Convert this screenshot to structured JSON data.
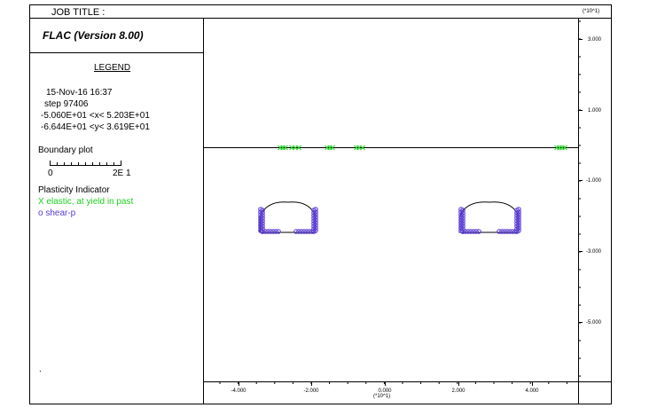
{
  "header": {
    "job_title_label": "JOB TITLE :",
    "y_scale_unit": "(*10^1)",
    "x_scale_unit": "(*10^1)"
  },
  "legend_panel": {
    "program_version": "FLAC (Version 8.00)",
    "legend_heading": "LEGEND",
    "date_time": "15-Nov-16  16:37",
    "step_line": "step    97406",
    "x_range_line": "-5.060E+01 <x<  5.203E+01",
    "y_range_line": "-6.644E+01 <y<  3.619E+01",
    "boundary_plot_label": "Boundary plot",
    "scale_bar_left": "0",
    "scale_bar_right": "2E  1",
    "plasticity_heading": "Plasticity Indicator",
    "elastic_label": "X elastic, at yield in past",
    "shear_label": "o shear-p",
    "footnote_mark": "."
  },
  "colors": {
    "elastic_marker": "#1fd11f",
    "shear_marker": "#5a3ad6",
    "frame": "#000000"
  },
  "axes": {
    "x_ticks": [
      "-4.000",
      "-2.000",
      "0.000",
      "2.000",
      "4.000"
    ],
    "y_ticks": [
      "3.000",
      "1.000",
      "-1.000",
      "-3.000",
      "-5.000"
    ]
  }
}
